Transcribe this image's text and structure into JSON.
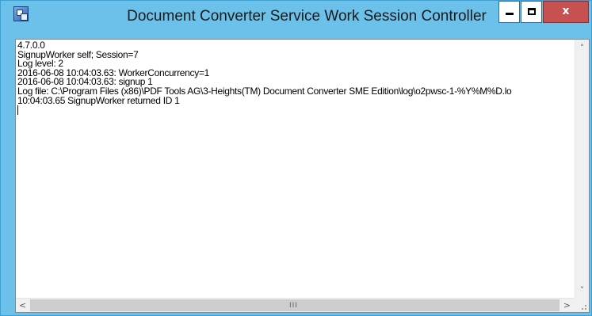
{
  "window": {
    "title": "Document Converter Service Work Session Controller",
    "icon": "app-window-icon",
    "controls": {
      "minimize_icon": "minimize-icon",
      "maximize_icon": "maximize-icon",
      "close_label": "x"
    }
  },
  "log": {
    "lines": [
      "4.7.0.0",
      "SignupWorker self; Session=7",
      "Log level: 2",
      "2016-06-08 10:04:03.63: WorkerConcurrency=1",
      "2016-06-08 10:04:03.63: signup 1",
      "Log file: C:\\Program Files (x86)\\PDF Tools AG\\3-Heights(TM) Document Converter SME Edition\\log\\o2pwsc-1-%Y%M%D.lo",
      "10:04:03.65 SignupWorker returned ID 1"
    ]
  },
  "scrollbars": {
    "vertical": {
      "up": "˄",
      "down": "˅"
    },
    "horizontal": {
      "left": "<",
      "right": ">",
      "grip": "III"
    }
  },
  "colors": {
    "frame": "#6cc1ea",
    "close_button": "#c75050"
  }
}
